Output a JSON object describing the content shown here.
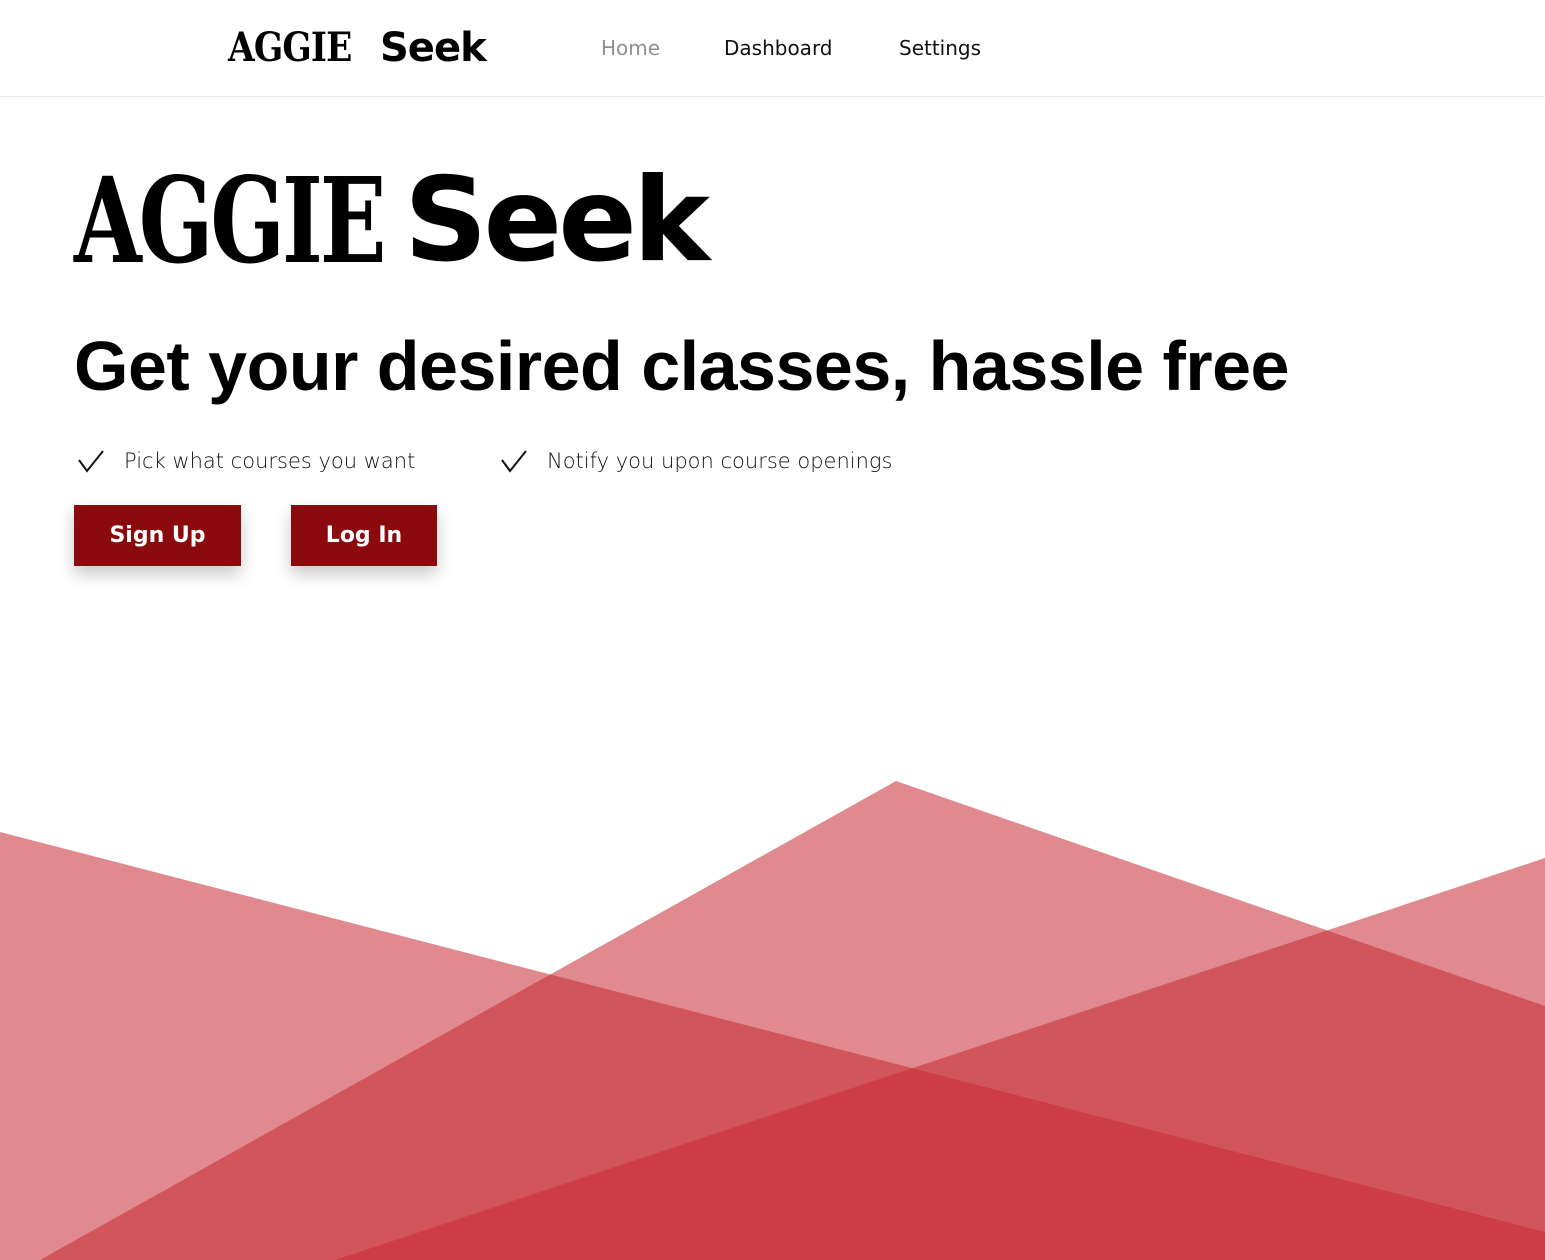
{
  "nav": {
    "brand_part1": "AGGIE",
    "brand_part2": "Seek",
    "links": [
      {
        "label": "Home",
        "active": true
      },
      {
        "label": "Dashboard",
        "active": false
      },
      {
        "label": "Settings",
        "active": false
      }
    ]
  },
  "hero": {
    "logo_part1": "AGGIE",
    "logo_part2": "Seek",
    "tagline": "Get your desired classes, hassle free",
    "features": [
      {
        "icon": "checkmark-icon",
        "text": "Pick what courses you want"
      },
      {
        "icon": "checkmark-icon",
        "text": "Notify you upon course openings"
      }
    ],
    "buttons": {
      "signup": "Sign Up",
      "login": "Log In"
    }
  },
  "colors": {
    "accent": "#8b0a0e",
    "shape": "#c62a33",
    "nav_active": "#8f8f8f"
  }
}
